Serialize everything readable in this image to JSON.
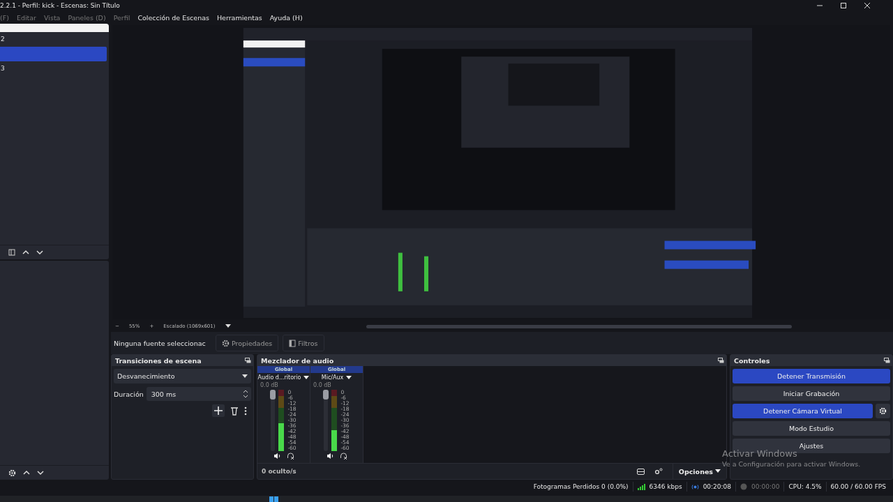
{
  "window": {
    "title": "2.2.1 - Perfil: kick - Escenas: Sin Título"
  },
  "menu": [
    {
      "label": "(F)",
      "disabled": true
    },
    {
      "label": "Editar",
      "disabled": true
    },
    {
      "label": "Vista",
      "disabled": true
    },
    {
      "label": "Paneles (D)",
      "disabled": true
    },
    {
      "label": "Perfil",
      "disabled": true
    },
    {
      "label": "Colección de Escenas",
      "disabled": false
    },
    {
      "label": "Herramientas",
      "disabled": false
    },
    {
      "label": "Ayuda (H)",
      "disabled": false
    }
  ],
  "scenes": [
    {
      "label": "2",
      "selected": false
    },
    {
      "selected": true
    },
    {
      "label": "3",
      "selected": false
    }
  ],
  "zoom_bar": {
    "minus": "−",
    "zoom": "55%",
    "plus": "+",
    "scale": "Escalado (1069x601)"
  },
  "source_bar": {
    "status": "Ninguna fuente seleccionac",
    "buttons": [
      "Propiedades",
      "Filtros"
    ]
  },
  "transitions": {
    "title": "Transiciones de escena",
    "transition": "Desvanecimiento",
    "duration_label": "Duración",
    "duration": "300 ms"
  },
  "mixer": {
    "title": "Mezclador de audio",
    "hidden": "0 oculto/s",
    "options": "Opciones",
    "channels": [
      {
        "header": "Global",
        "name": "Audio d...ritorio",
        "reading": "0.0 dB",
        "level": 0.45,
        "fader": {
          "level": 1
        },
        "scale": [
          "0",
          "-6",
          "-12",
          "-18",
          "-24",
          "-30",
          "-36",
          "-42",
          "-48",
          "-54",
          "-60"
        ]
      },
      {
        "header": "Global",
        "name": "Mic/Aux",
        "reading": "0.0 dB",
        "level": 0.34,
        "fader": {
          "level": 1
        },
        "scale": [
          "0",
          "-6",
          "-12",
          "-18",
          "-24",
          "-30",
          "-36",
          "-42",
          "-48",
          "-54",
          "-60"
        ]
      }
    ]
  },
  "controls": {
    "title": "Controles",
    "buttons": [
      {
        "label": "Detener Transmisión",
        "active": true,
        "settings": false
      },
      {
        "label": "Iniciar Grabación",
        "active": false,
        "settings": false
      },
      {
        "label": "Detener Cámara Virtual",
        "active": true,
        "settings": true
      },
      {
        "label": "Modo Estudio",
        "active": false,
        "settings": false
      },
      {
        "label": "Ajustes",
        "active": false,
        "settings": false
      }
    ]
  },
  "status_bar": {
    "dropped": "Fotogramas Perdidos 0 (0.0%)",
    "bitrate": "6346 kbps",
    "stream_time": "00:20:08",
    "record_time": "00:00:00",
    "cpu": "CPU: 4.5%",
    "fps": "60.00 / 60.00 FPS"
  },
  "os_notice": {
    "title": "Activar Windows",
    "text": "Ve a Configuración para activar Windows."
  }
}
